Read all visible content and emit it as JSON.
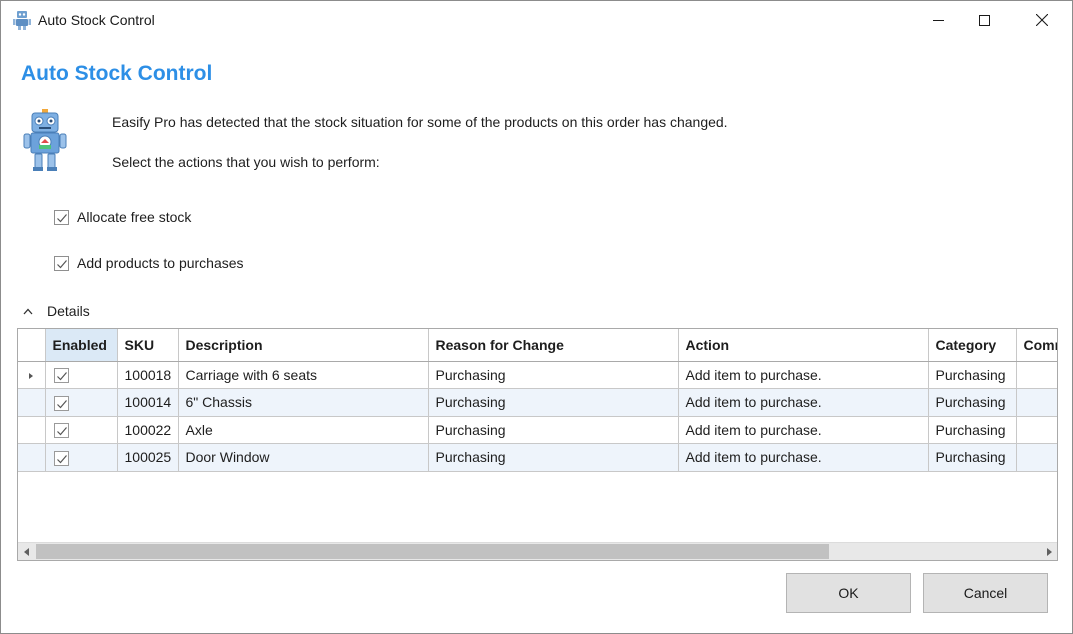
{
  "window": {
    "title": "Auto Stock Control"
  },
  "header": {
    "title": "Auto Stock Control",
    "line1": "Easify Pro has detected that the stock situation for some of the products on this order has changed.",
    "line2": "Select the actions that you wish to perform:"
  },
  "options": [
    {
      "label": "Allocate free stock",
      "checked": true
    },
    {
      "label": "Add products to purchases",
      "checked": true
    }
  ],
  "details": {
    "label": "Details",
    "expanded": true
  },
  "grid": {
    "columns": [
      "Enabled",
      "SKU",
      "Description",
      "Reason for Change",
      "Action",
      "Category",
      "Comr"
    ],
    "rows": [
      {
        "enabled": true,
        "sku": "100018",
        "description": "Carriage with 6 seats",
        "reason": "Purchasing",
        "action": "Add item to purchase.",
        "category": "Purchasing",
        "comment": ""
      },
      {
        "enabled": true,
        "sku": "100014",
        "description": "6\" Chassis",
        "reason": "Purchasing",
        "action": "Add item to purchase.",
        "category": "Purchasing",
        "comment": ""
      },
      {
        "enabled": true,
        "sku": "100022",
        "description": "Axle",
        "reason": "Purchasing",
        "action": "Add item to purchase.",
        "category": "Purchasing",
        "comment": ""
      },
      {
        "enabled": true,
        "sku": "100025",
        "description": "Door Window",
        "reason": "Purchasing",
        "action": "Add item to purchase.",
        "category": "Purchasing",
        "comment": ""
      }
    ]
  },
  "buttons": {
    "ok": "OK",
    "cancel": "Cancel"
  },
  "colors": {
    "accent": "#2d8fe6",
    "alt_row": "#eef4fb",
    "header_selected": "#dbe9f6"
  }
}
